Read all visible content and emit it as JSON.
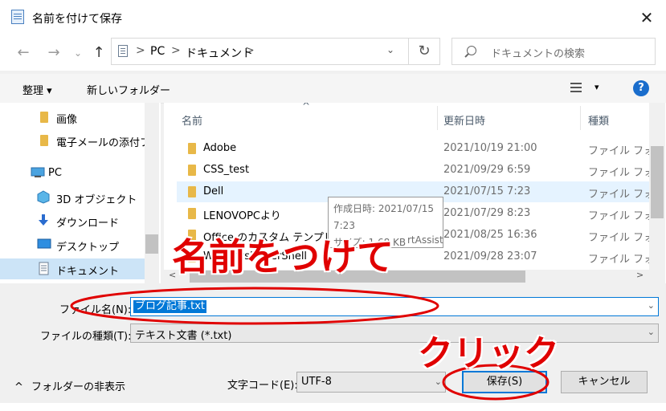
{
  "window": {
    "title": "名前を付けて保存",
    "close_glyph": "✕"
  },
  "nav": {
    "back": "←",
    "forward": "→",
    "history": "⌄",
    "up": "↑",
    "refresh": "↻"
  },
  "address": {
    "crumbs": [
      "PC",
      "ドキュメント"
    ],
    "sep": ">",
    "dropdown": "⌄"
  },
  "search": {
    "placeholder": "ドキュメントの検索"
  },
  "toolbar": {
    "organize": "整理 ▾",
    "new_folder": "新しいフォルダー",
    "view_arrow": "▾",
    "help": "?"
  },
  "sidebar": {
    "items": [
      {
        "label": "画像",
        "icon": "folder-icon"
      },
      {
        "label": "電子メールの添付フ",
        "icon": "folder-icon"
      },
      {
        "label": "PC",
        "icon": "pc-icon"
      },
      {
        "label": "3D オブジェクト",
        "icon": "cube-icon"
      },
      {
        "label": "ダウンロード",
        "icon": "download-icon"
      },
      {
        "label": "デスクトップ",
        "icon": "desktop-icon"
      },
      {
        "label": "ドキュメント",
        "icon": "document-icon",
        "selected": true
      }
    ]
  },
  "files": {
    "columns": [
      "名前",
      "更新日時",
      "種類"
    ],
    "sort_glyph": "^",
    "rows": [
      {
        "name": "Adobe",
        "date": "2021/10/19 21:00",
        "type": "ファイル フォル"
      },
      {
        "name": "CSS_test",
        "date": "2021/09/29 6:59",
        "type": "ファイル フォル"
      },
      {
        "name": "Dell",
        "date": "2021/07/15 7:23",
        "type": "ファイル フォル"
      },
      {
        "name": "LENOVOPCより",
        "date": "2021/07/29 8:23",
        "type": "ファイル フォル"
      },
      {
        "name": "Office のカスタム テンプレート",
        "date": "2021/08/25 16:36",
        "type": "ファイル フォル"
      },
      {
        "name": "WindowsPowerShell",
        "date": "2021/09/28 23:07",
        "type": "ファイル フォル"
      }
    ],
    "scroll_left": "<",
    "scroll_right": ">"
  },
  "tooltip": {
    "created": "作成日時: 2021/07/15 7:23",
    "size": "サイズ: 1.68 KB",
    "extra": "rtAssist"
  },
  "form": {
    "filename_label": "ファイル名(N):",
    "filename_value": "ブログ記事.txt",
    "filetype_label": "ファイルの種類(T):",
    "filetype_value": "テキスト文書 (*.txt)",
    "encoding_label": "文字コード(E):",
    "encoding_value": "UTF-8",
    "dd": "⌄"
  },
  "buttons": {
    "save": "保存(S)",
    "cancel": "キャンセル",
    "hide_folders": "フォルダーの非表示",
    "hide_glyph": "^"
  },
  "annotations": {
    "name_hint": "名前をつけて",
    "click_hint": "クリック",
    "color": "#e00000"
  }
}
